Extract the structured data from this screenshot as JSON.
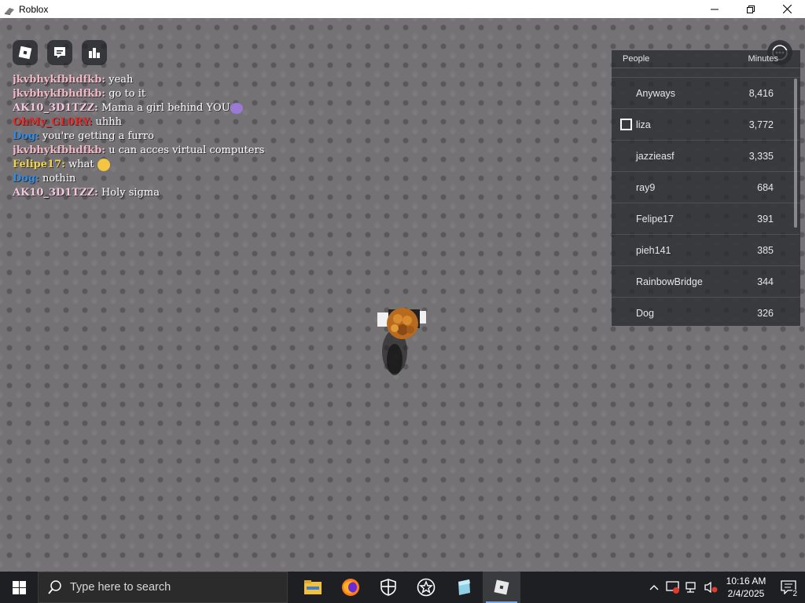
{
  "window": {
    "title": "Roblox"
  },
  "topbar": {
    "buttons": [
      "roblox-menu-icon",
      "chat-icon",
      "leaderboard-icon"
    ],
    "menu_icon": "more-icon"
  },
  "chat": {
    "lines": [
      {
        "name": "jkvbhykfbhdfkb:",
        "text": "yeah",
        "color": "#f2b8c6"
      },
      {
        "name": "jkvbhykfbhdfkb:",
        "text": "go to it",
        "color": "#f2b8c6"
      },
      {
        "name": "AK10_3D1TZZ:",
        "text": "Mama a girl behind YOU",
        "color": "#f5c7dc"
      },
      {
        "name": "OhMy_GL0RY:",
        "text": "uhhh",
        "color": "#e82a2a"
      },
      {
        "name": "Dog:",
        "text": "you're getting a furro",
        "color": "#2e8be6"
      },
      {
        "name": "jkvbhykfbhdfkb:",
        "text": "u can acces virtual computers",
        "color": "#f2b8c6"
      },
      {
        "name": "Felipe17:",
        "text": "what",
        "color": "#f1d24c"
      },
      {
        "name": "Dog:",
        "text": "nothin",
        "color": "#2e8be6"
      },
      {
        "name": "AK10_3D1TZZ:",
        "text": "Holy sigma",
        "color": "#f5c7dc"
      }
    ]
  },
  "playerlist": {
    "col_people": "People",
    "col_minutes": "Minutes",
    "rows": [
      {
        "name": "Anyways",
        "minutes": "8,416"
      },
      {
        "name": "liza",
        "minutes": "3,772"
      },
      {
        "name": "jazzieasf",
        "minutes": "3,335"
      },
      {
        "name": "ray9",
        "minutes": "684"
      },
      {
        "name": "Felipe17",
        "minutes": "391"
      },
      {
        "name": "pieh141",
        "minutes": "385"
      },
      {
        "name": "RainbowBridge",
        "minutes": "344"
      },
      {
        "name": "Dog",
        "minutes": "326"
      }
    ]
  },
  "taskbar": {
    "search_placeholder": "Type here to search",
    "apps": [
      "file-explorer-icon",
      "firefox-icon",
      "security-shield-icon",
      "star-app-icon",
      "notes-app-icon",
      "roblox-taskbar-icon"
    ],
    "time": "10:16 AM",
    "date": "2/4/2025",
    "notification_count": "2"
  }
}
